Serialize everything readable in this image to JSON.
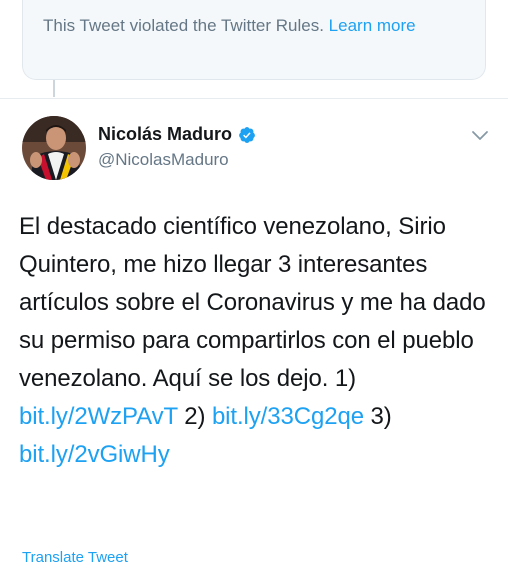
{
  "notice": {
    "text": "This Tweet violated the Twitter Rules. ",
    "link": "Learn more"
  },
  "tweet": {
    "author_name": "Nicolás Maduro",
    "handle": "@NicolasMaduro",
    "verified": true,
    "text_segments": [
      "El destacado científico venezolano, Sirio Quintero, me hizo llegar 3 interesantes artículos sobre el Coronavirus y me ha dado su permiso para compartirlos con el pueblo venezolano. Aquí se los dejo. 1) ",
      " 2) ",
      " 3) "
    ],
    "links": [
      "bit.ly/2WzPAvT",
      "bit.ly/33Cg2qe",
      "bit.ly/2vGiwHy"
    ],
    "translate_label": "Translate Tweet"
  },
  "colors": {
    "link": "#1da1f2",
    "secondary_text": "#657786",
    "verified": "#1da1f2"
  },
  "icons": {
    "verified": "verified-badge-icon",
    "menu": "chevron-down-icon"
  }
}
